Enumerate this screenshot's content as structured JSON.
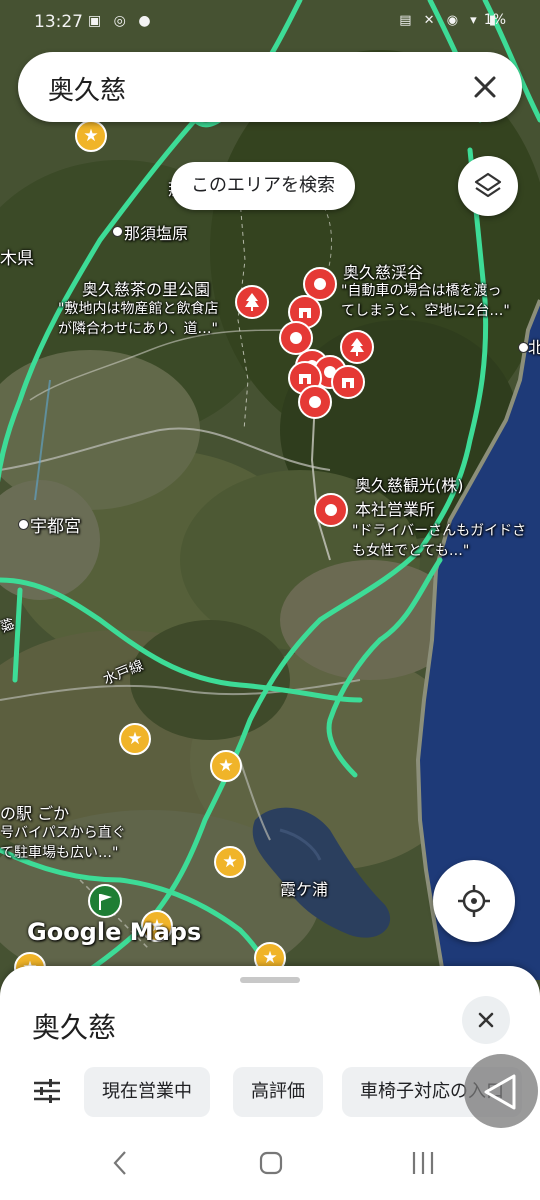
{
  "status_bar": {
    "time": "13:27",
    "left_icons": "▣ ◎ ●",
    "right_icons": "▤ ✕ ◉ ▾ ▮",
    "battery": "1%"
  },
  "search": {
    "query": "奥久慈"
  },
  "map_controls": {
    "search_this_area": "このエリアを検索"
  },
  "map_labels": {
    "tochigi": "木県",
    "nasushiobara": "那須塩原",
    "utsunomiya": "宇都宮",
    "mito_line": "水戸線",
    "line_left": "線",
    "kasumigaura": "霞ケ浦",
    "north": "北",
    "road_station": "の駅 ごか",
    "road_station_desc1": "号バイパスから直ぐ",
    "road_station_desc2": "て駐車場も広い…\"",
    "partial_top": "那",
    "watermark": "Google"
  },
  "places": [
    {
      "name": "奥久慈茶の里公園",
      "snippet1": "\"敷地内は物産館と飲食店",
      "snippet2": "が隣合わせにあり、道…\""
    },
    {
      "name": "奥久慈渓谷",
      "snippet1": "\"自動車の場合は橋を渡っ",
      "snippet2": "てしまうと、空地に2台…\""
    },
    {
      "name": "奥久慈観光(株)",
      "name2": "本社営業所",
      "snippet1": "\"ドライバーさんもガイドさ",
      "snippet2": "も女性でとても…\""
    }
  ],
  "logo": "Google Maps",
  "sheet": {
    "title": "奥久慈",
    "chips": [
      "現在営業中",
      "高評価",
      "車椅子対応の入口"
    ]
  },
  "colors": {
    "highway": "#3ddc97",
    "pin": "#e53935",
    "star": "#f0b429",
    "sea": "#1e3a78"
  }
}
